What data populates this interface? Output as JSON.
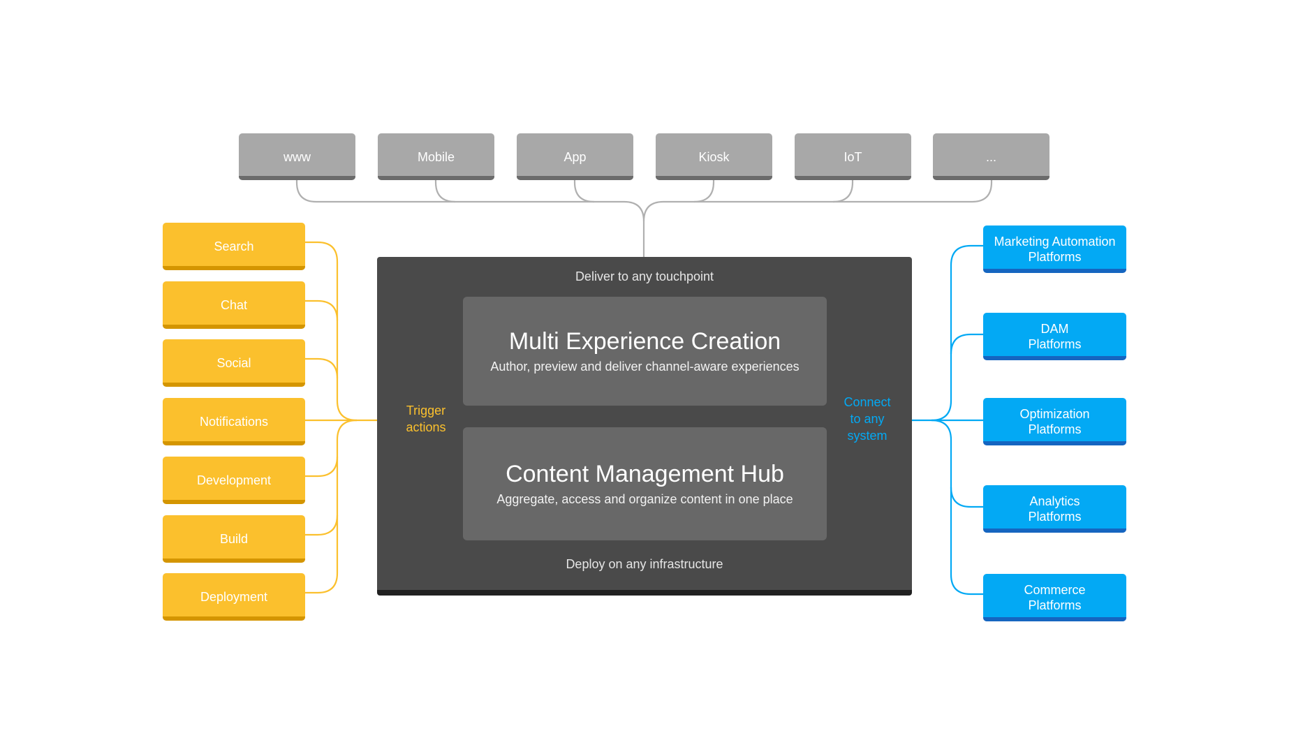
{
  "touchpoints": [
    "www",
    "Mobile",
    "App",
    "Kiosk",
    "IoT",
    "..."
  ],
  "triggers": [
    "Search",
    "Chat",
    "Social",
    "Notifications",
    "Development",
    "Build",
    "Deployment"
  ],
  "systems": [
    {
      "line1": "Marketing Automation",
      "line2": "Platforms"
    },
    {
      "line1": "DAM",
      "line2": "Platforms"
    },
    {
      "line1": "Optimization",
      "line2": "Platforms"
    },
    {
      "line1": "Analytics",
      "line2": "Platforms"
    },
    {
      "line1": "Commerce",
      "line2": "Platforms"
    }
  ],
  "panel": {
    "top_caption": "Deliver to any touchpoint",
    "bottom_caption": "Deploy on any infrastructure",
    "trigger_label": {
      "line1": "Trigger",
      "line2": "actions"
    },
    "connect_label": {
      "line1": "Connect",
      "line2": "to any",
      "line3": "system"
    },
    "experience": {
      "title": "Multi Experience Creation",
      "subtitle": "Author, preview and deliver channel-aware experiences"
    },
    "hub": {
      "title": "Content Management Hub",
      "subtitle": "Aggregate, access and organize content in one place"
    }
  },
  "colors": {
    "touchpoint": "#a8a8a8",
    "trigger": "#fbc02d",
    "system": "#03a9f4",
    "panel": "#4a4a4a",
    "inner": "#686868",
    "wire_grey": "#b0b0b0"
  }
}
